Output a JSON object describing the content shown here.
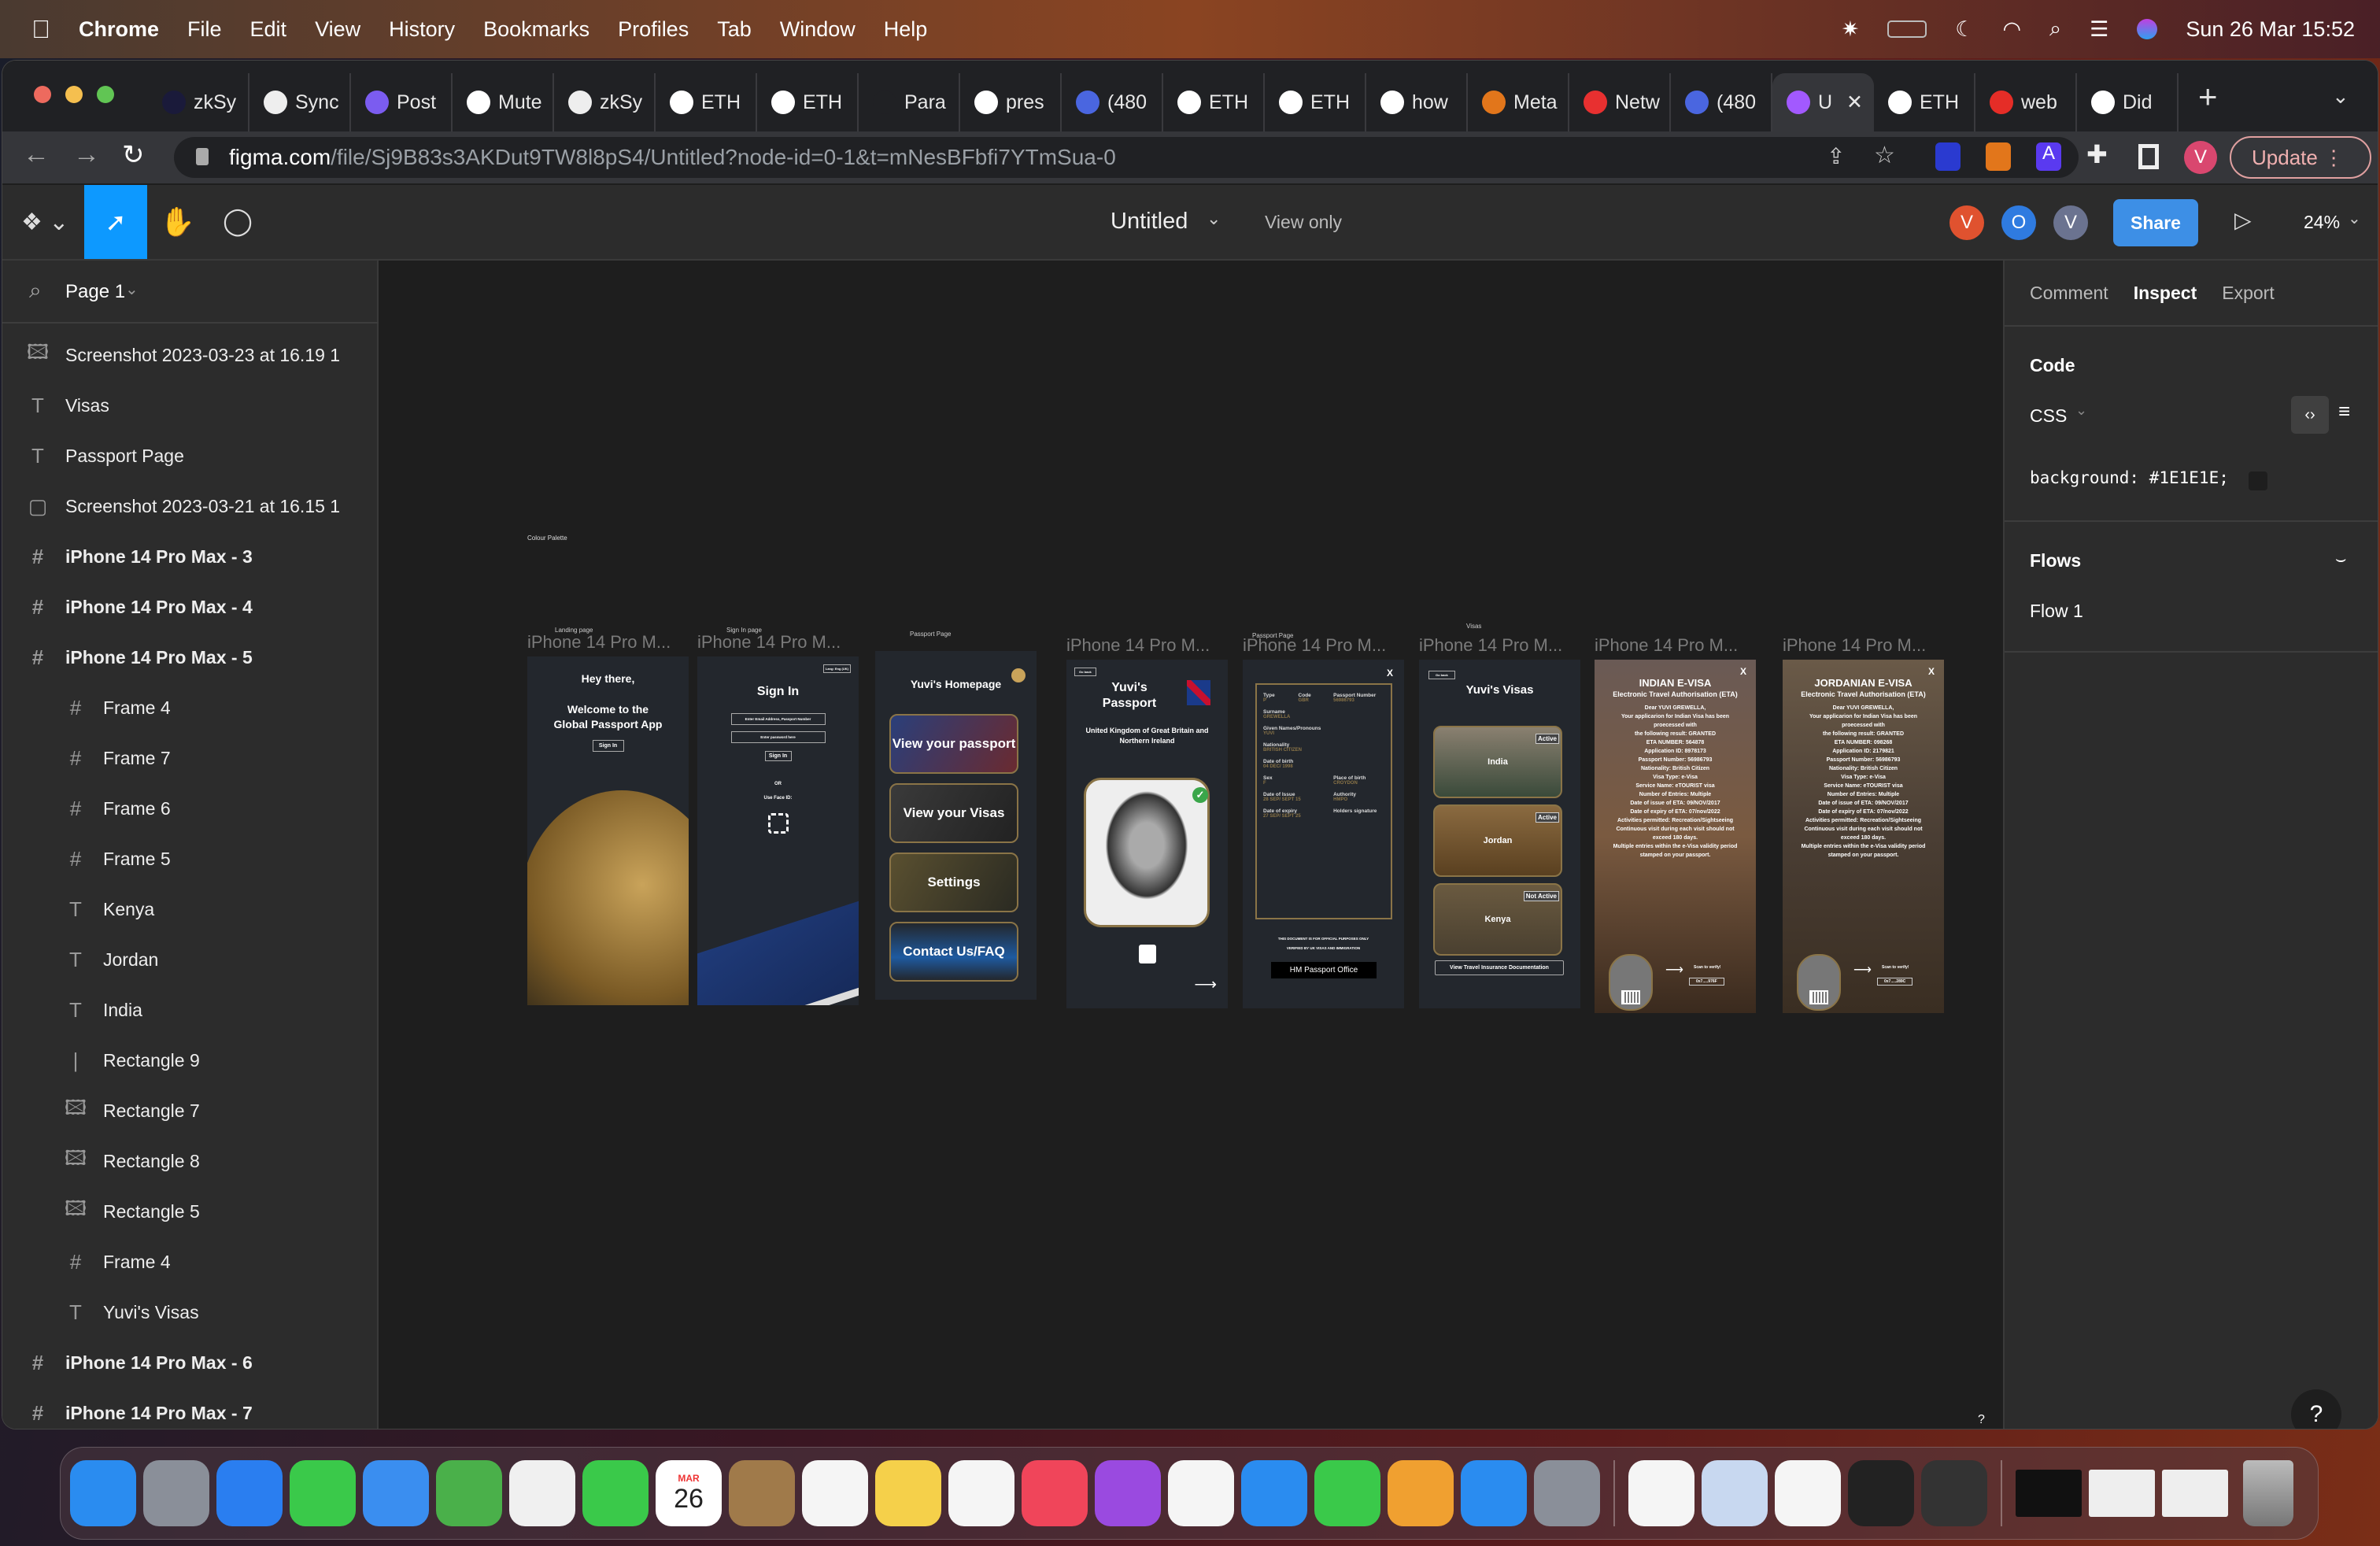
{
  "menubar": {
    "app": "Chrome",
    "items": [
      "File",
      "Edit",
      "View",
      "History",
      "Bookmarks",
      "Profiles",
      "Tab",
      "Window",
      "Help"
    ],
    "clock": "Sun 26 Mar  15:52"
  },
  "browser": {
    "tabs": [
      {
        "title": "zkSy",
        "color": "#1a1a3a"
      },
      {
        "title": "Sync",
        "color": "#eee"
      },
      {
        "title": "Post",
        "color": "#7b5cf0"
      },
      {
        "title": "Mute",
        "color": "#fff"
      },
      {
        "title": "zkSy",
        "color": "#eee"
      },
      {
        "title": "ETH",
        "color": "#fff"
      },
      {
        "title": "ETH",
        "color": "#fff"
      },
      {
        "title": "Para",
        "color": "#202124"
      },
      {
        "title": "pres",
        "color": "#fff"
      },
      {
        "title": "(480",
        "color": "#4a66e0"
      },
      {
        "title": "ETH",
        "color": "#fff"
      },
      {
        "title": "ETH",
        "color": "#fff"
      },
      {
        "title": "how",
        "color": "#fff"
      },
      {
        "title": "Meta",
        "color": "#e2761b"
      },
      {
        "title": "Netw",
        "color": "#e83030"
      },
      {
        "title": "(480",
        "color": "#4a66e0"
      },
      {
        "title": "U",
        "color": "#a259ff",
        "active": true
      },
      {
        "title": "ETH",
        "color": "#fff"
      },
      {
        "title": "web",
        "color": "#e52d27"
      },
      {
        "title": "Did",
        "color": "#fff"
      }
    ],
    "url_host": "figma.com",
    "url_path": "/file/Sj9B83s3AKDut9TW8l8pS4/Untitled?node-id=0-1&t=mNesBFbfi7YTmSua-0",
    "update_label": "Update",
    "profile_initial": "V"
  },
  "figma": {
    "file_title": "Untitled",
    "view_mode": "View only",
    "share_label": "Share",
    "zoom": "24%",
    "avatars": [
      {
        "initial": "V",
        "color": "#e0522f"
      },
      {
        "initial": "O",
        "color": "#2f7be0"
      },
      {
        "initial": "V",
        "color": "#6b7390"
      }
    ],
    "page": "Page 1",
    "layers": [
      {
        "name": "Screenshot 2023-03-23 at 16.19 1",
        "icon": "image-icon",
        "indent": 0,
        "bold": false
      },
      {
        "name": "Visas",
        "icon": "text-icon",
        "indent": 0,
        "bold": false
      },
      {
        "name": "Passport Page",
        "icon": "text-icon",
        "indent": 0,
        "bold": false
      },
      {
        "name": "Screenshot 2023-03-21 at 16.15 1",
        "icon": "rectangle-icon",
        "indent": 0,
        "bold": false
      },
      {
        "name": "iPhone 14 Pro Max - 3",
        "icon": "frame-icon",
        "indent": 0,
        "bold": true
      },
      {
        "name": "iPhone 14 Pro Max - 4",
        "icon": "frame-icon",
        "indent": 0,
        "bold": true
      },
      {
        "name": "iPhone 14 Pro Max - 5",
        "icon": "frame-icon",
        "indent": 0,
        "bold": true
      },
      {
        "name": "Frame 4",
        "icon": "frame-icon",
        "indent": 1,
        "bold": false
      },
      {
        "name": "Frame 7",
        "icon": "frame-icon",
        "indent": 1,
        "bold": false
      },
      {
        "name": "Frame 6",
        "icon": "frame-icon",
        "indent": 1,
        "bold": false
      },
      {
        "name": "Frame 5",
        "icon": "frame-icon",
        "indent": 1,
        "bold": false
      },
      {
        "name": "Kenya",
        "icon": "text-icon",
        "indent": 1,
        "bold": false
      },
      {
        "name": "Jordan",
        "icon": "text-icon",
        "indent": 1,
        "bold": false
      },
      {
        "name": "India",
        "icon": "text-icon",
        "indent": 1,
        "bold": false
      },
      {
        "name": "Rectangle 9",
        "icon": "line-icon",
        "indent": 1,
        "bold": false
      },
      {
        "name": "Rectangle 7",
        "icon": "image-icon",
        "indent": 1,
        "bold": false
      },
      {
        "name": "Rectangle 8",
        "icon": "image-icon",
        "indent": 1,
        "bold": false
      },
      {
        "name": "Rectangle 5",
        "icon": "image-icon",
        "indent": 1,
        "bold": false
      },
      {
        "name": "Frame 4",
        "icon": "frame-icon",
        "indent": 1,
        "bold": false
      },
      {
        "name": "Yuvi's Visas",
        "icon": "text-icon",
        "indent": 1,
        "bold": false
      },
      {
        "name": "iPhone 14 Pro Max - 6",
        "icon": "frame-icon",
        "indent": 0,
        "bold": true
      },
      {
        "name": "iPhone 14 Pro Max - 7",
        "icon": "frame-icon",
        "indent": 0,
        "bold": true
      }
    ],
    "inspect": {
      "tabs": [
        "Comment",
        "Inspect",
        "Export"
      ],
      "active_tab": "Inspect",
      "code_heading": "Code",
      "language": "CSS",
      "css_line": "background: #1E1E1E;",
      "swatch": "#1E1E1E",
      "flows_heading": "Flows",
      "flow": "Flow 1",
      "help": "?"
    },
    "canvas": {
      "colour_palette": "Colour Palette",
      "frame_label": "iPhone 14 Pro M...",
      "small_labels": {
        "landing": "Landing page",
        "signin": "Sign In page",
        "passport": "Passport Page",
        "passport2": "Passport Page",
        "visas": "Visas"
      },
      "landing": {
        "greeting": "Hey there,",
        "welcome": "Welcome to the Global Passport App",
        "signin": "Sign In"
      },
      "signin": {
        "lang": "Lang: Eng (UK)",
        "title": "Sign In",
        "email_placeholder": "Enter Email Address, Passport Number",
        "password_placeholder": "Enter password here",
        "button": "Sign In",
        "or": "OR",
        "faceid": "Use Face ID:"
      },
      "home": {
        "title": "Yuvi's Homepage",
        "cards": [
          "View your passport",
          "View your Visas",
          "Settings",
          "Contact Us/FAQ"
        ]
      },
      "passport": {
        "back": "Go back",
        "title": "Yuvi's Passport",
        "country": "United Kingdom of Great Britain and Northern Ireland"
      },
      "passport_detail": {
        "close": "X",
        "fields": [
          [
            "Type",
            "P"
          ],
          [
            "Code",
            "GBR"
          ],
          [
            "Passport Number",
            "56986793"
          ],
          [
            "Surname",
            "GREWELLA"
          ],
          [
            "Given Names/Pronouns",
            "YUVI"
          ],
          [
            "Nationality",
            "BRITISH CITIZEN"
          ],
          [
            "Date of birth",
            "04 DEC/ 1998"
          ],
          [
            "Sex",
            "F"
          ],
          [
            "Place of birth",
            "CROYDON"
          ],
          [
            "Date of Issue",
            "28 SEP/ SEPT 15"
          ],
          [
            "Authority",
            "HMPO"
          ],
          [
            "Date of expiry",
            "27 SEP/ SEPT 25"
          ],
          [
            "Holders signature",
            ""
          ]
        ],
        "footer1": "THIS DOCUMENT IS FOR OFFICIAL PURPOSES ONLY",
        "footer2": "VERIFIED BY UK VISAS AND IMMIGRATION",
        "office": "HM Passport Office"
      },
      "visas": {
        "back": "Go back",
        "title": "Yuvi's Visas",
        "items": [
          {
            "name": "India",
            "status": "Active"
          },
          {
            "name": "Jordan",
            "status": "Active"
          },
          {
            "name": "Kenya",
            "status": "Not Active"
          }
        ],
        "insurance": "View Travel Insurance Documentation"
      },
      "indian_visa": {
        "close": "X",
        "title": "INDIAN E-VISA",
        "subtitle": "Electronic Travel Authorisation (ETA)",
        "lines": [
          "Dear YUVI GREWELLA,",
          "Your applicarion for Indian Visa has been",
          "proecessed with",
          "the following result: GRANTED",
          "ETA NUMBER: 564878",
          "",
          "Application ID: 8978173",
          "Passport Number: 56986793",
          "Nationality: British Citizen",
          "Visa Type: e-Visa",
          "Service Name: eTOURIST visa",
          "Number of Entries: Multiple",
          "Date of issue of ETA: 09/NOV/2017",
          "Date of expiry of ETA: 07/nov/2022",
          "Activities permitted: Recreation/Sightseeing",
          "Continuous visit during each visit should not",
          "exceed 180 days.",
          "Multiple entries within the e-Visa validity period",
          "stamped on your passport."
        ],
        "scan": "Scan to verify!",
        "hash": "0x7.....976F"
      },
      "jordan_visa": {
        "close": "X",
        "title": "JORDANIAN E-VISA",
        "subtitle": "Electronic Travel Authorisation (ETA)",
        "lines": [
          "Dear YUVI GREWELLA,",
          "Your applicarion for Indian Visa has been",
          "proecessed with",
          "the following result: GRANTED",
          "ETA NUMBER: 098268",
          "",
          "Application ID: 2179821",
          "Passport Number: 56986793",
          "Nationality: British Citizen",
          "Visa Type: e-Visa",
          "Service Name: eTOURIST visa",
          "Number of Entries: Multiple",
          "Date of issue of ETA: 09/NOV/2017",
          "Date of expiry of ETA: 07/nov/2022",
          "Activities permitted: Recreation/Sightseeing",
          "Continuous visit during each visit should not",
          "exceed 180 days.",
          "Multiple entries within the e-Visa validity period",
          "stamped on your passport."
        ],
        "scan": "Scan to verify!",
        "hash": "0x7.....289C"
      }
    }
  },
  "dock": {
    "apps": [
      {
        "name": "finder",
        "color": "#2a8cf0"
      },
      {
        "name": "launchpad",
        "color": "#8a8f99"
      },
      {
        "name": "safari",
        "color": "#2a7ef0"
      },
      {
        "name": "messages",
        "color": "#3ac94a"
      },
      {
        "name": "mail",
        "color": "#3a8ef0"
      },
      {
        "name": "maps",
        "color": "#4ab04a"
      },
      {
        "name": "photos",
        "color": "#f0f0f0"
      },
      {
        "name": "facetime",
        "color": "#3ac94a"
      },
      {
        "name": "calendar",
        "color": "#ffffff",
        "label": "26",
        "month": "MAR"
      },
      {
        "name": "contacts",
        "color": "#a07a4a"
      },
      {
        "name": "reminders",
        "color": "#f5f5f5"
      },
      {
        "name": "notes",
        "color": "#f5d04a"
      },
      {
        "name": "freeform",
        "color": "#f5f5f5"
      },
      {
        "name": "music",
        "color": "#f0455a"
      },
      {
        "name": "podcasts",
        "color": "#9a4ae0"
      },
      {
        "name": "news",
        "color": "#f5f5f5"
      },
      {
        "name": "keynote",
        "color": "#2a8cf0"
      },
      {
        "name": "numbers",
        "color": "#3ac94a"
      },
      {
        "name": "pages",
        "color": "#f0a030"
      },
      {
        "name": "app-store",
        "color": "#2a8cf0"
      },
      {
        "name": "system-settings",
        "color": "#8a8f99"
      },
      {
        "name": "chrome",
        "color": "#f5f5f5"
      },
      {
        "name": "preview",
        "color": "#c8d8f0"
      },
      {
        "name": "vscode",
        "color": "#f5f5f5"
      },
      {
        "name": "terminal",
        "color": "#222"
      },
      {
        "name": "quicktime",
        "color": "#333"
      }
    ]
  }
}
